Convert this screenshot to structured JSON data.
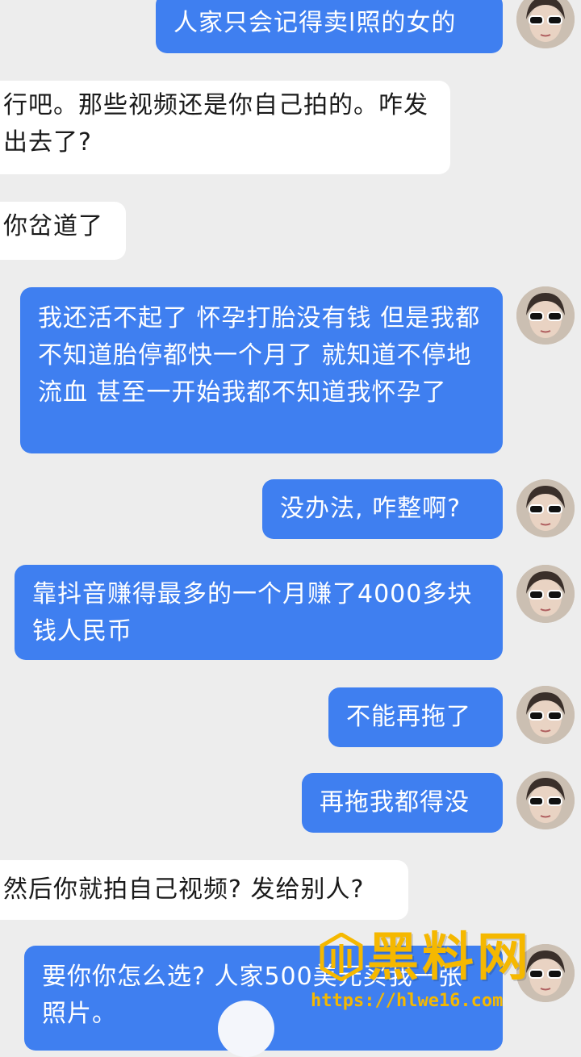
{
  "messages": [
    {
      "side": "out",
      "text": "人家只会记得卖l照的女的"
    },
    {
      "side": "in",
      "text": "行吧。那些视频还是你自己拍的。咋发出去了?"
    },
    {
      "side": "in",
      "text": "你岔道了"
    },
    {
      "side": "out",
      "text": "我还活不起了 怀孕打胎没有钱 但是我都不知道胎停都快一个月了 就知道不停地流血 甚至一开始我都不知道我怀孕了"
    },
    {
      "side": "out",
      "text": "没办法, 咋整啊?"
    },
    {
      "side": "out",
      "text": "靠抖音赚得最多的一个月赚了4000多块钱人民币"
    },
    {
      "side": "out",
      "text": "不能再拖了"
    },
    {
      "side": "out",
      "text": "再拖我都得没"
    },
    {
      "side": "in",
      "text": "然后你就拍自己视频? 发给别人?"
    },
    {
      "side": "out",
      "text": "要你你怎么选? 人家500美元买我一张照片。"
    }
  ],
  "avatar": {
    "icon": "user-avatar-sunglasses-icon"
  },
  "watermark": {
    "brand": "黑料网",
    "url": "https://hlwe16.com"
  },
  "colors": {
    "outgoing": "#3f7ff0",
    "incoming": "#ffffff",
    "background": "#ededed",
    "watermark": "#f5b800"
  }
}
